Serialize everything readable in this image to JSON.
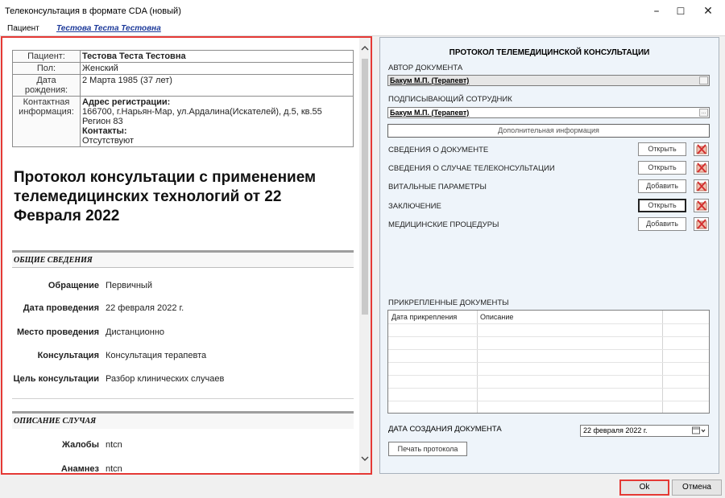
{
  "window": {
    "title": "Телеконсультация в формате CDA (новый)",
    "minimize": "–",
    "maximize": "☐",
    "close": "✕"
  },
  "patient_bar": {
    "label": "Пациент",
    "link": "Тестова Теста Тестовна"
  },
  "patient_table": {
    "patient_label": "Пациент:",
    "patient_value": "Тестова Теста Тестовна",
    "sex_label": "Пол:",
    "sex_value": "Женский",
    "birth_label": "Дата рождения:",
    "birth_value": "2 Марта 1985 (37 лет)",
    "contact_label": "Контактная информация:",
    "address_header": "Адрес регистрации:",
    "address_value": "166700, г.Нарьян-Мар, ул.Ардалина(Искателей), д.5, кв.55",
    "region": "Регион 83",
    "contacts_header": "Контакты:",
    "contacts_value": "Отсутствуют"
  },
  "document": {
    "title": "Протокол консультации с применением телемедицинских технологий от 22 Февраля 2022",
    "general_section": "ОБЩИЕ СВЕДЕНИЯ",
    "case_section": "ОПИСАНИЕ СЛУЧАЯ",
    "fields": {
      "appeal_label": "Обращение",
      "appeal_value": "Первичный",
      "date_label": "Дата проведения",
      "date_value": "22 февраля 2022 г.",
      "place_label": "Место проведения",
      "place_value": "Дистанционно",
      "consultation_label": "Консультация",
      "consultation_value": "Консультация терапевта",
      "goal_label": "Цель консультации",
      "goal_value": "Разбор клинических случаев",
      "complaints_label": "Жалобы",
      "complaints_value": "ntcn",
      "anamnesis_label": "Анамнез",
      "anamnesis_value": "ntcn"
    }
  },
  "right_panel": {
    "title": "ПРОТОКОЛ ТЕЛЕМЕДИЦИНСКОЙ КОНСУЛЬТАЦИИ",
    "author_label": "АВТОР ДОКУМЕНТА",
    "author_value": "Бакум М.П. (Терапевт)",
    "signer_label": "ПОДПИСЫВАЮЩИЙ СОТРУДНИК",
    "signer_value": "Бакум М.П. (Терапевт)",
    "browse_glyph": "...",
    "extra_info_button": "Дополнительная информация",
    "sections": [
      {
        "label": "СВЕДЕНИЯ О ДОКУМЕНТЕ",
        "button": "Открыть"
      },
      {
        "label": "СВЕДЕНИЯ О СЛУЧАЕ ТЕЛЕКОНСУЛЬТАЦИИ",
        "button": "Открыть"
      },
      {
        "label": "ВИТАЛЬНЫЕ ПАРАМЕТРЫ",
        "button": "Добавить"
      },
      {
        "label": "ЗАКЛЮЧЕНИЕ",
        "button": "Открыть"
      },
      {
        "label": "МЕДИЦИНСКИЕ ПРОЦЕДУРЫ",
        "button": "Добавить"
      }
    ],
    "attached_label": "ПРИКРЕПЛЕННЫЕ ДОКУМЕНТЫ",
    "grid_columns": [
      "Дата прикрепления",
      "Описание"
    ],
    "creation_date_label": "ДАТА СОЗДАНИЯ ДОКУМЕНТА",
    "creation_date_value": "22 февраля  2022 г.",
    "print_button": "Печать протокола"
  },
  "footer": {
    "ok": "Ok",
    "cancel": "Отмена"
  },
  "colors": {
    "highlight": "#e53935",
    "link": "#1d3a9a",
    "panel_bg": "#eef4fa",
    "delete_icon": "#d32f2f"
  }
}
